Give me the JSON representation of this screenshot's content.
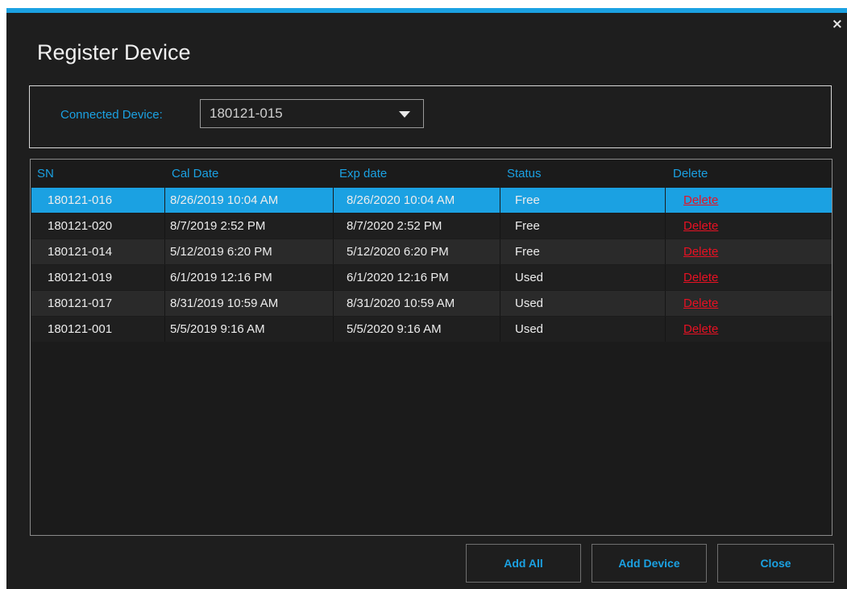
{
  "dialog": {
    "title": "Register Device",
    "close_glyph": "×"
  },
  "device": {
    "label": "Connected Device:",
    "selected": "180121-015"
  },
  "table": {
    "columns": [
      "SN",
      "Cal Date",
      "Exp date",
      "Status",
      "Delete"
    ],
    "rows": [
      {
        "sn": "180121-016",
        "cal": "8/26/2019 10:04 AM",
        "exp": "8/26/2020 10:04 AM",
        "status": "Free",
        "action": "Delete"
      },
      {
        "sn": "180121-020",
        "cal": "8/7/2019 2:52 PM",
        "exp": "8/7/2020 2:52 PM",
        "status": "Free",
        "action": "Delete"
      },
      {
        "sn": "180121-014",
        "cal": "5/12/2019 6:20 PM",
        "exp": "5/12/2020 6:20 PM",
        "status": "Free",
        "action": "Delete"
      },
      {
        "sn": "180121-019",
        "cal": "6/1/2019 12:16 PM",
        "exp": "6/1/2020 12:16 PM",
        "status": "Used",
        "action": "Delete"
      },
      {
        "sn": "180121-017",
        "cal": "8/31/2019 10:59 AM",
        "exp": "8/31/2020 10:59 AM",
        "status": "Used",
        "action": "Delete"
      },
      {
        "sn": "180121-001",
        "cal": "5/5/2019 9:16 AM",
        "exp": "5/5/2020 9:16 AM",
        "status": "Used",
        "action": "Delete"
      }
    ]
  },
  "buttons": {
    "add_all": "Add All",
    "add_device": "Add Device",
    "close": "Close"
  },
  "colors": {
    "accent": "#1ba1e2",
    "background": "#1e1e1e",
    "delete": "#e81123"
  }
}
